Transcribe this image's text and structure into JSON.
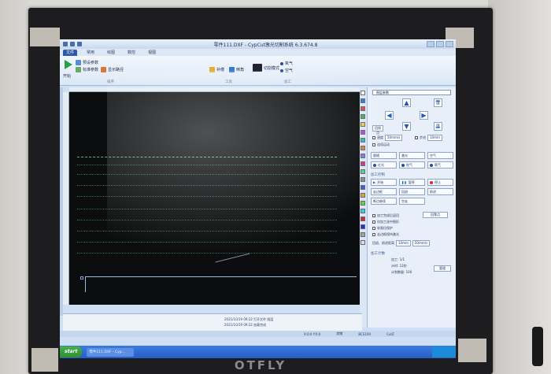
{
  "window": {
    "title": "零件111.DXF - CypCut激光切割系统 6.3.674.8",
    "min": "─",
    "max": "□",
    "close": "×"
  },
  "menu": {
    "tabs": [
      "文件",
      "常用",
      "绘图",
      "数控",
      "视图"
    ]
  },
  "ribbon": {
    "start_label": "开始",
    "items": [
      "预设参数",
      "标准参数",
      "显示路径",
      "补偿",
      "倒角",
      "切割模式",
      "微连",
      "阵列"
    ],
    "group_labels": [
      "工具",
      "排序",
      "加工"
    ],
    "radio_options": [
      "氧气",
      "空气"
    ]
  },
  "canvas": {
    "ruler_ticks": [
      "0",
      "500",
      "1000",
      "1500",
      "2000",
      "2500"
    ]
  },
  "right_panel": {
    "layer_select": "图层参数",
    "speed_label": "速度",
    "speed_value": "50mm/s",
    "step_label": "步进",
    "step_value": "10mm",
    "continuous_label": "连续运动",
    "btn_return": "回原点",
    "btn_laser": "激光",
    "btn_red": "红光",
    "btn_blow": "吹气",
    "btn_air": "空气",
    "btn_oxy": "氧气",
    "btn_focus": "跟随",
    "machining_title": "加工控制",
    "btn_start": "开始",
    "btn_pause": "暂停",
    "btn_stop": "停止",
    "btn_frame": "走边框",
    "btn_air_move": "空走",
    "btn_back": "回退",
    "btn_breakpoint": "断点继续",
    "btn_forward": "前进",
    "checks": [
      "加工完成后返回",
      "仅加工选中图形",
      "软限位保护",
      "走边框保持激光"
    ],
    "finish_label": "回零点",
    "frame_speed_label": "回退、前进距离",
    "frame_speed_value": "10mm",
    "frame_speed_value2": "50mm/s",
    "count_title": "加工计数",
    "count_lines": [
      "加工: 1/1",
      "计时: 12秒",
      "计划数量: 100"
    ],
    "manage_label": "管理"
  },
  "log": {
    "lines": [
      "2021/10/19 09:22 打开文件 图层",
      "2021/10/19 09:22 加载完成"
    ]
  },
  "status": {
    "items": [
      "X:0.0 Y:0.0",
      "就绪",
      "BCS100",
      "CutZ"
    ]
  },
  "taskbar": {
    "start": "start",
    "item": "零件111.DXF - Cyp..."
  },
  "monitor": {
    "brand": "OTFLY"
  },
  "colors": {
    "swatches": [
      "#ffffff",
      "#2b7bd6",
      "#d64a4a",
      "#3bb24a",
      "#e5d03a",
      "#b04ad6",
      "#2ab6b6",
      "#e07a2a",
      "#7a7ad6",
      "#d62a7a",
      "#4ad68a",
      "#8a8a8a",
      "#3a5ad6",
      "#d6a82a",
      "#6ad62a",
      "#2ad6d6",
      "#d62a2a",
      "#2a2ad6",
      "#a2a2a2",
      "#e0e0e0"
    ]
  }
}
